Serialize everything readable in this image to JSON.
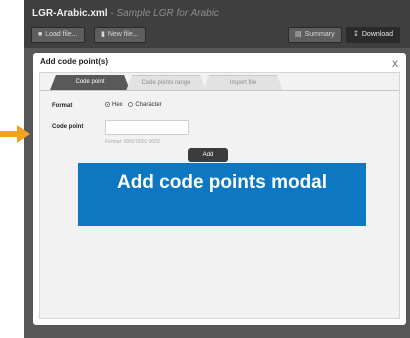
{
  "app": {
    "title": "LGR-Arabic.xml",
    "subtitle": "- Sample LGR for Arabic"
  },
  "toolbar": {
    "load_file_label": "Load file...",
    "new_file_label": "New file...",
    "summary_label": "Summary",
    "download_label": "Download"
  },
  "modal": {
    "title": "Add code point(s)",
    "close_label": "X",
    "tabs": [
      {
        "label": "Code point",
        "active": true
      },
      {
        "label": "Code points range",
        "active": false
      },
      {
        "label": "Import file",
        "active": false
      }
    ],
    "format_label": "Format",
    "format_options": [
      {
        "label": "Hex",
        "selected": true
      },
      {
        "label": "Character",
        "selected": false
      }
    ],
    "code_point_label": "Code point",
    "code_point_value": "",
    "code_point_hint": "Format: 0000 0001 0002",
    "add_label": "Add"
  },
  "annotation": {
    "text": "Add code points modal",
    "color": "#0d77c2",
    "arrow_color": "#f3a21b"
  }
}
